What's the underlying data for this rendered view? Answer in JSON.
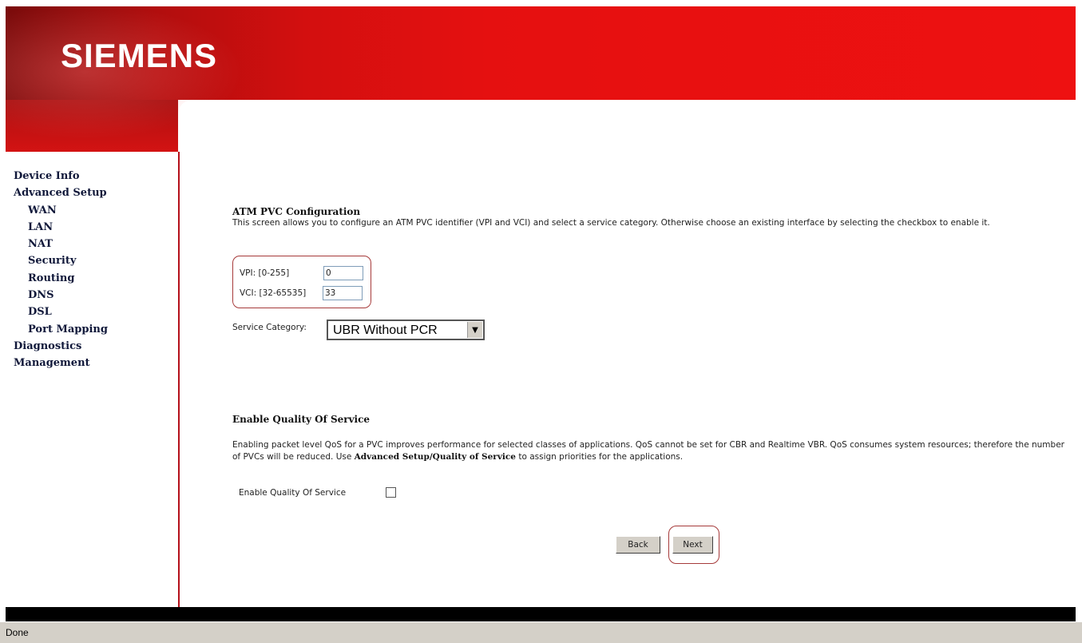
{
  "brand": {
    "logo_text": "SIEMENS"
  },
  "sidebar": {
    "items": [
      {
        "label": "Device Info"
      },
      {
        "label": "Advanced Setup"
      },
      {
        "label": "WAN"
      },
      {
        "label": "LAN"
      },
      {
        "label": "NAT"
      },
      {
        "label": "Security"
      },
      {
        "label": "Routing"
      },
      {
        "label": "DNS"
      },
      {
        "label": "DSL"
      },
      {
        "label": "Port Mapping"
      },
      {
        "label": "Diagnostics"
      },
      {
        "label": "Management"
      }
    ]
  },
  "atm": {
    "title": "ATM PVC Configuration",
    "description": "This screen allows you to configure an ATM PVC identifier (VPI and VCI) and select a service category. Otherwise choose an existing interface by selecting the checkbox to enable it.",
    "vpi_label": "VPI: [0-255]",
    "vpi_value": "0",
    "vci_label": "VCI: [32-65535]",
    "vci_value": "33",
    "service_label": "Service Category:",
    "service_value": "UBR Without PCR"
  },
  "qos": {
    "title": "Enable Quality Of Service",
    "desc_part1": "Enabling packet level QoS for a PVC improves performance for selected classes of applications.  QoS cannot be set for CBR and Realtime VBR.  QoS consumes system resources; therefore the number of PVCs will be reduced. Use ",
    "desc_bold": "Advanced Setup/Quality of Service",
    "desc_part2": " to assign priorities for the applications.",
    "checkbox_label": "Enable Quality Of Service",
    "checked": false
  },
  "buttons": {
    "back": "Back",
    "next": "Next"
  },
  "status": {
    "text": "Done"
  },
  "colors": {
    "brand_red": "#e51010",
    "annotation_ring": "#a63a3a"
  }
}
